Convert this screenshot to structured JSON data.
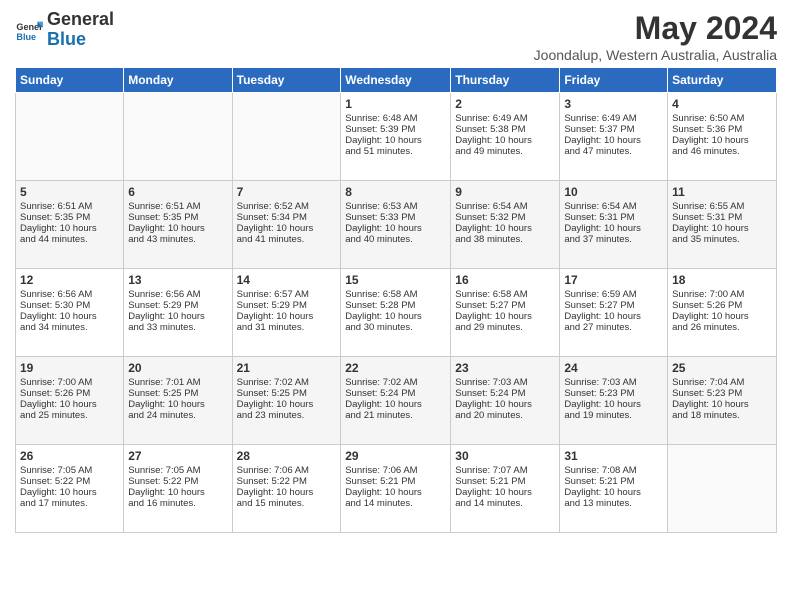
{
  "logo": {
    "text_general": "General",
    "text_blue": "Blue"
  },
  "header": {
    "month_year": "May 2024",
    "location": "Joondalup, Western Australia, Australia"
  },
  "days_of_week": [
    "Sunday",
    "Monday",
    "Tuesday",
    "Wednesday",
    "Thursday",
    "Friday",
    "Saturday"
  ],
  "weeks": [
    [
      {
        "day": "",
        "content": ""
      },
      {
        "day": "",
        "content": ""
      },
      {
        "day": "",
        "content": ""
      },
      {
        "day": "1",
        "content": "Sunrise: 6:48 AM\nSunset: 5:39 PM\nDaylight: 10 hours\nand 51 minutes."
      },
      {
        "day": "2",
        "content": "Sunrise: 6:49 AM\nSunset: 5:38 PM\nDaylight: 10 hours\nand 49 minutes."
      },
      {
        "day": "3",
        "content": "Sunrise: 6:49 AM\nSunset: 5:37 PM\nDaylight: 10 hours\nand 47 minutes."
      },
      {
        "day": "4",
        "content": "Sunrise: 6:50 AM\nSunset: 5:36 PM\nDaylight: 10 hours\nand 46 minutes."
      }
    ],
    [
      {
        "day": "5",
        "content": "Sunrise: 6:51 AM\nSunset: 5:35 PM\nDaylight: 10 hours\nand 44 minutes."
      },
      {
        "day": "6",
        "content": "Sunrise: 6:51 AM\nSunset: 5:35 PM\nDaylight: 10 hours\nand 43 minutes."
      },
      {
        "day": "7",
        "content": "Sunrise: 6:52 AM\nSunset: 5:34 PM\nDaylight: 10 hours\nand 41 minutes."
      },
      {
        "day": "8",
        "content": "Sunrise: 6:53 AM\nSunset: 5:33 PM\nDaylight: 10 hours\nand 40 minutes."
      },
      {
        "day": "9",
        "content": "Sunrise: 6:54 AM\nSunset: 5:32 PM\nDaylight: 10 hours\nand 38 minutes."
      },
      {
        "day": "10",
        "content": "Sunrise: 6:54 AM\nSunset: 5:31 PM\nDaylight: 10 hours\nand 37 minutes."
      },
      {
        "day": "11",
        "content": "Sunrise: 6:55 AM\nSunset: 5:31 PM\nDaylight: 10 hours\nand 35 minutes."
      }
    ],
    [
      {
        "day": "12",
        "content": "Sunrise: 6:56 AM\nSunset: 5:30 PM\nDaylight: 10 hours\nand 34 minutes."
      },
      {
        "day": "13",
        "content": "Sunrise: 6:56 AM\nSunset: 5:29 PM\nDaylight: 10 hours\nand 33 minutes."
      },
      {
        "day": "14",
        "content": "Sunrise: 6:57 AM\nSunset: 5:29 PM\nDaylight: 10 hours\nand 31 minutes."
      },
      {
        "day": "15",
        "content": "Sunrise: 6:58 AM\nSunset: 5:28 PM\nDaylight: 10 hours\nand 30 minutes."
      },
      {
        "day": "16",
        "content": "Sunrise: 6:58 AM\nSunset: 5:27 PM\nDaylight: 10 hours\nand 29 minutes."
      },
      {
        "day": "17",
        "content": "Sunrise: 6:59 AM\nSunset: 5:27 PM\nDaylight: 10 hours\nand 27 minutes."
      },
      {
        "day": "18",
        "content": "Sunrise: 7:00 AM\nSunset: 5:26 PM\nDaylight: 10 hours\nand 26 minutes."
      }
    ],
    [
      {
        "day": "19",
        "content": "Sunrise: 7:00 AM\nSunset: 5:26 PM\nDaylight: 10 hours\nand 25 minutes."
      },
      {
        "day": "20",
        "content": "Sunrise: 7:01 AM\nSunset: 5:25 PM\nDaylight: 10 hours\nand 24 minutes."
      },
      {
        "day": "21",
        "content": "Sunrise: 7:02 AM\nSunset: 5:25 PM\nDaylight: 10 hours\nand 23 minutes."
      },
      {
        "day": "22",
        "content": "Sunrise: 7:02 AM\nSunset: 5:24 PM\nDaylight: 10 hours\nand 21 minutes."
      },
      {
        "day": "23",
        "content": "Sunrise: 7:03 AM\nSunset: 5:24 PM\nDaylight: 10 hours\nand 20 minutes."
      },
      {
        "day": "24",
        "content": "Sunrise: 7:03 AM\nSunset: 5:23 PM\nDaylight: 10 hours\nand 19 minutes."
      },
      {
        "day": "25",
        "content": "Sunrise: 7:04 AM\nSunset: 5:23 PM\nDaylight: 10 hours\nand 18 minutes."
      }
    ],
    [
      {
        "day": "26",
        "content": "Sunrise: 7:05 AM\nSunset: 5:22 PM\nDaylight: 10 hours\nand 17 minutes."
      },
      {
        "day": "27",
        "content": "Sunrise: 7:05 AM\nSunset: 5:22 PM\nDaylight: 10 hours\nand 16 minutes."
      },
      {
        "day": "28",
        "content": "Sunrise: 7:06 AM\nSunset: 5:22 PM\nDaylight: 10 hours\nand 15 minutes."
      },
      {
        "day": "29",
        "content": "Sunrise: 7:06 AM\nSunset: 5:21 PM\nDaylight: 10 hours\nand 14 minutes."
      },
      {
        "day": "30",
        "content": "Sunrise: 7:07 AM\nSunset: 5:21 PM\nDaylight: 10 hours\nand 14 minutes."
      },
      {
        "day": "31",
        "content": "Sunrise: 7:08 AM\nSunset: 5:21 PM\nDaylight: 10 hours\nand 13 minutes."
      },
      {
        "day": "",
        "content": ""
      }
    ]
  ]
}
